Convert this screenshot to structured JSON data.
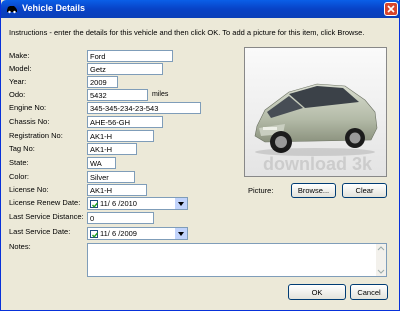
{
  "window": {
    "title": "Vehicle Details"
  },
  "instructions": "Instructions - enter the details for this vehicle and then click OK. To add a picture for this item, click Browse.",
  "fields": {
    "make": {
      "label": "Make:",
      "value": "Ford"
    },
    "model": {
      "label": "Model:",
      "value": "Getz"
    },
    "year": {
      "label": "Year:",
      "value": "2009"
    },
    "odo": {
      "label": "Odo:",
      "value": "5432",
      "suffix": "miles"
    },
    "engine": {
      "label": "Engine No:",
      "value": "345-345-234-23-543"
    },
    "chassis": {
      "label": "Chassis No:",
      "value": "AHE-56-GH"
    },
    "registration": {
      "label": "Registration No:",
      "value": "AK1-H"
    },
    "tag": {
      "label": "Tag No:",
      "value": "AK1-H"
    },
    "state": {
      "label": "State:",
      "value": "WA"
    },
    "color": {
      "label": "Color:",
      "value": "Silver"
    },
    "license": {
      "label": "License No:",
      "value": "AK1-H"
    },
    "license_renew": {
      "label": "License Renew Date:",
      "value": "11/ 6 /2010",
      "checked": true
    },
    "last_service_distance": {
      "label": "Last Service Distance:",
      "value": "0"
    },
    "last_service_date": {
      "label": "Last Service Date:",
      "value": "11/ 6 /2009",
      "checked": true
    },
    "notes": {
      "label": "Notes:",
      "value": ""
    }
  },
  "picture": {
    "label": "Picture:",
    "browse_label": "Browse...",
    "clear_label": "Clear",
    "watermark": "download 3k"
  },
  "buttons": {
    "ok": "OK",
    "cancel": "Cancel"
  },
  "colors": {
    "titlebar": "#0842c6",
    "window_bg": "#ece9d8",
    "field_border": "#7f9db9",
    "car_body": "#b9c0ad"
  }
}
